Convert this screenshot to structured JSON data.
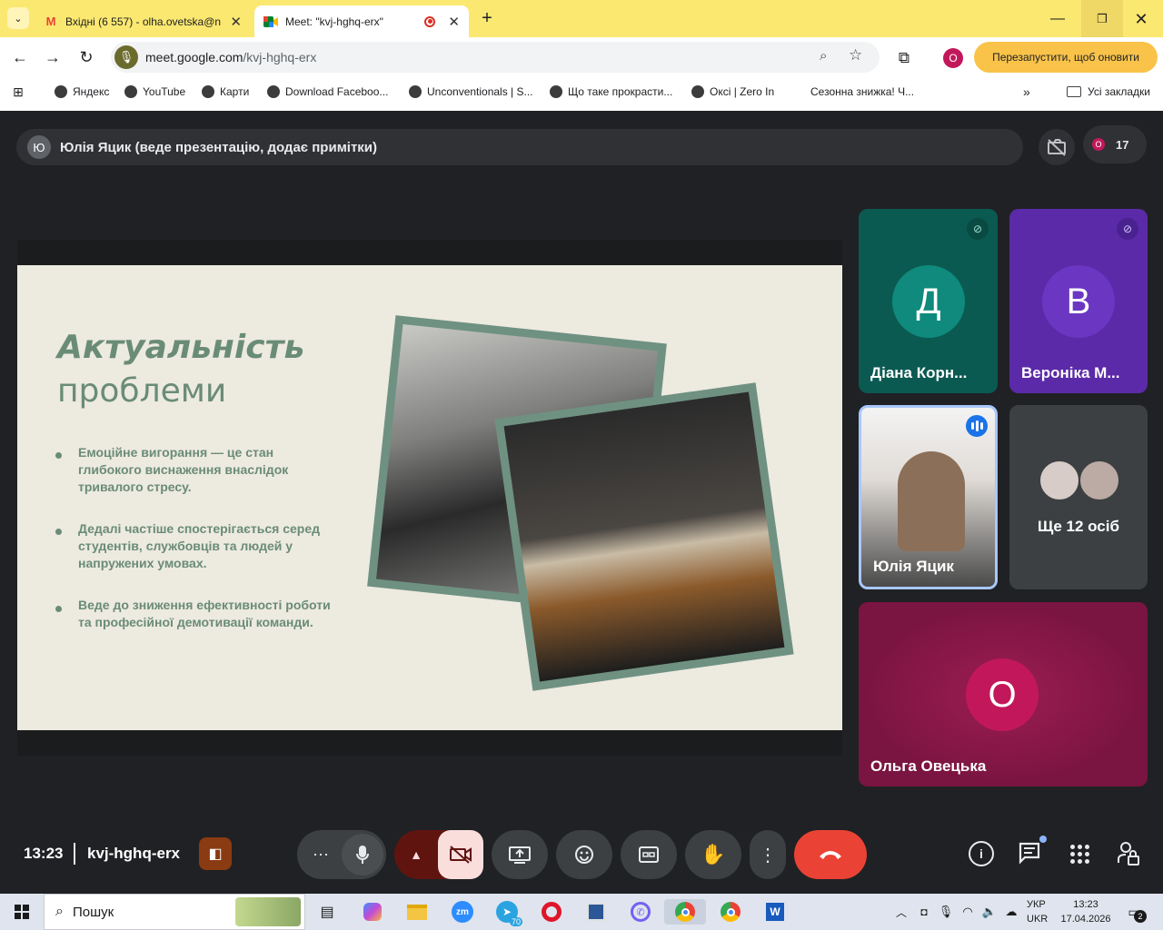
{
  "browser": {
    "tabs": [
      {
        "title": "Вхідні (6 557) - olha.ovetska@n"
      },
      {
        "title": "Meet: \"kvj-hghq-erx\""
      }
    ],
    "url_domain": "meet.google.com",
    "url_path": "/kvj-hghq-erx",
    "profile_initial": "O",
    "update_button": "Перезапустити, щоб оновити",
    "bookmarks": [
      "Яндекс",
      "YouTube",
      "Карти",
      "Download Faceboo...",
      "Unconventionals | S...",
      "Що таке прокрасти...",
      "Оксі | Zero In",
      "Сезонна знижка! Ч..."
    ],
    "all_bookmarks": "Усі закладки",
    "colors": {
      "tabbar": "#fbe870",
      "accent": "#f9c349"
    }
  },
  "meet": {
    "presenter_initial": "Ю",
    "presenter_text": "Юлія Яцик (веде презентацію, додає примітки)",
    "participant_count": "17",
    "participant_mini_initial": "O",
    "slide": {
      "title_bold": "Актуальність",
      "title_rest": "проблеми",
      "bullets": [
        "Емоційне вигорання — це стан глибокого виснаження внаслідок тривалого стресу.",
        "Дедалі частіше спостерігається серед студентів, службовців та людей у напружених умовах.",
        "Веде до зниження ефективності роботи та професійної демотивації команди."
      ],
      "colors": {
        "background": "#edeae0",
        "accent": "#6a8c77",
        "frame": "#6f9182"
      }
    },
    "tiles": [
      {
        "initial": "Д",
        "name": "Діана Корн...",
        "muted": true,
        "bg": "#0b5a52",
        "avatar": "#0f8a7d"
      },
      {
        "initial": "В",
        "name": "Вероніка М...",
        "muted": true,
        "bg": "#5b2aa8",
        "avatar": "#6a36c2"
      },
      {
        "name": "Юлія Яцик",
        "speaking": true
      },
      {
        "more": "Ще 12 осіб"
      },
      {
        "initial": "O",
        "name": "Ольга Овецька",
        "bg": "#7a1440",
        "avatar": "#c2185b"
      }
    ],
    "time": "13:23",
    "meeting_code": "kvj-hghq-erx",
    "end_call_color": "#ea4335"
  },
  "taskbar": {
    "search_placeholder": "Пошук",
    "telegram_badge": "70",
    "lang1": "УКР",
    "lang2": "UKR",
    "clock_time": "13:23",
    "clock_date": "17.04.2026",
    "notifications": "2"
  }
}
